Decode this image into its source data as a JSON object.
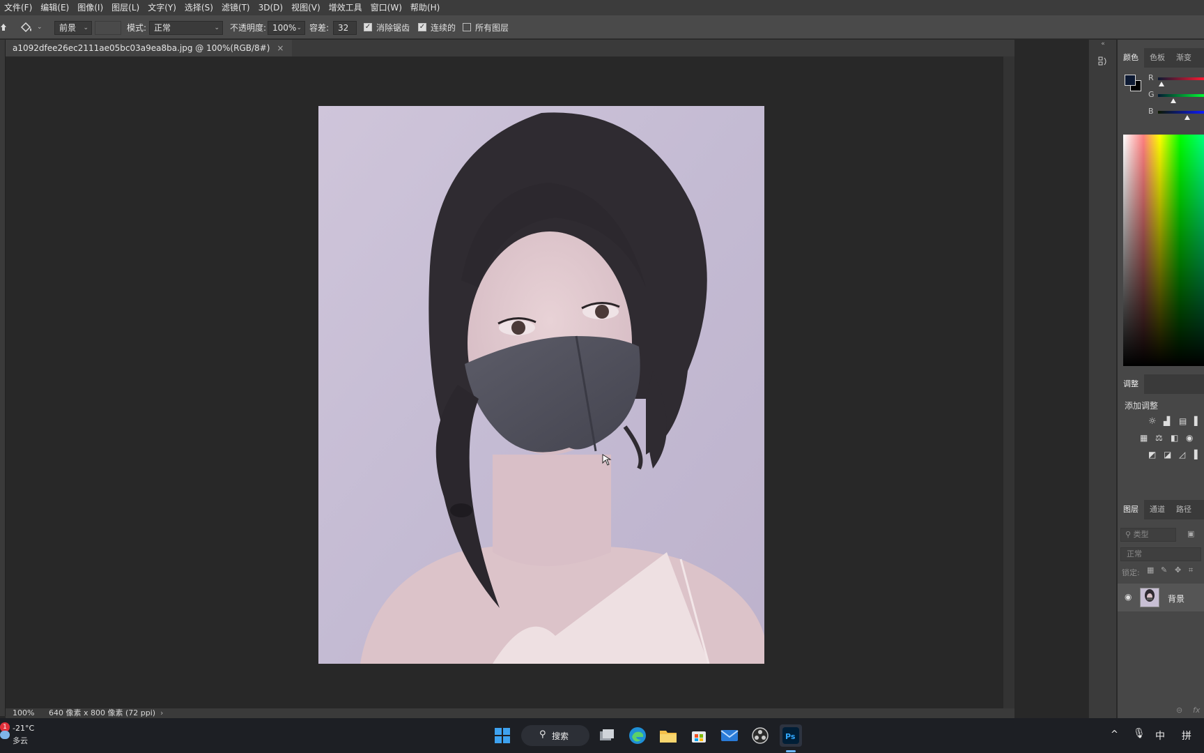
{
  "menu": [
    "文件(F)",
    "编辑(E)",
    "图像(I)",
    "图层(L)",
    "文字(Y)",
    "选择(S)",
    "滤镜(T)",
    "3D(D)",
    "视图(V)",
    "增效工具",
    "窗口(W)",
    "帮助(H)"
  ],
  "options": {
    "fill_source": "前景",
    "mode_label": "模式:",
    "mode_value": "正常",
    "opacity_label": "不透明度:",
    "opacity_value": "100%",
    "tolerance_label": "容差:",
    "tolerance_value": "32",
    "antialias_label": "消除锯齿",
    "contiguous_label": "连续的",
    "all_layers_label": "所有图层",
    "antialias_checked": true,
    "contiguous_checked": true,
    "all_layers_checked": false
  },
  "document": {
    "tab_title": "a1092dfee26ec2111ae05bc03a9ea8ba.jpg @ 100%(RGB/8#)",
    "close_symbol": "×"
  },
  "status": {
    "zoom": "100%",
    "dimensions": "640 像素 x 800 像素 (72 ppi)",
    "arrow": "›"
  },
  "color_panel": {
    "tabs": [
      "颜色",
      "色板",
      "渐变"
    ],
    "channels": [
      "R",
      "G",
      "B"
    ],
    "foreground": "#0d1a33",
    "background": "#000000"
  },
  "adjust_panel": {
    "tab": "调整",
    "title": "添加调整"
  },
  "layers_panel": {
    "tabs": [
      "图层",
      "通道",
      "路径"
    ],
    "search_placeholder": "类型",
    "blend_mode": "正常",
    "lock_label": "锁定:",
    "layers": [
      {
        "name": "背景"
      }
    ]
  },
  "taskbar": {
    "notification_count": "1",
    "temperature": "-21°C",
    "weather": "多云",
    "search_label": "搜索",
    "ime_lang": "中",
    "ime_mode": "拼"
  }
}
